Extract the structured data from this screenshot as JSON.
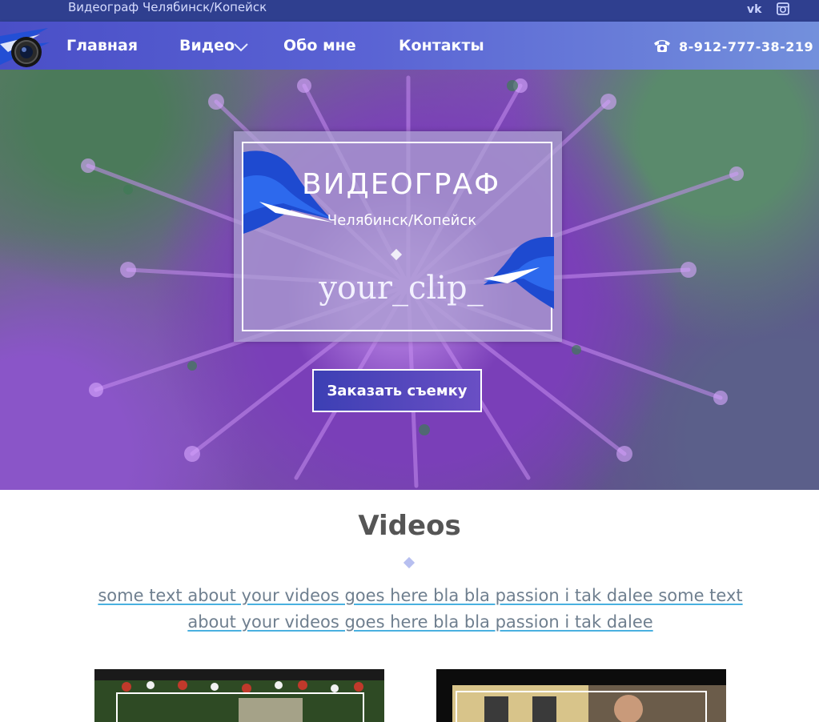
{
  "topbar": {
    "site_name": "Видеограф Челябинск/Копейск",
    "social": [
      "vk-icon",
      "instagram-icon"
    ]
  },
  "nav": {
    "items": [
      {
        "label": "Главная"
      },
      {
        "label": "Видео"
      },
      {
        "label": "Обо мне"
      },
      {
        "label": "Контакты"
      }
    ],
    "phone": "8-912-777-38-219"
  },
  "hero": {
    "title": "ВИДЕОГРАФ",
    "subtitle": "Челябинск/Копейск",
    "clip": "your_clip_",
    "button": "Заказать съемку"
  },
  "videos": {
    "title": "Videos",
    "description": "some text about your videos goes here bla bla passion i tak dalee some text about your videos goes here bla bla passion i tak dalee"
  },
  "colors": {
    "topbar": "#2f3f8f",
    "nav_start": "#4a4fc7",
    "nav_end": "#7390dc",
    "accent_link": "#49b0e0",
    "diamond": "#b7bff0"
  }
}
